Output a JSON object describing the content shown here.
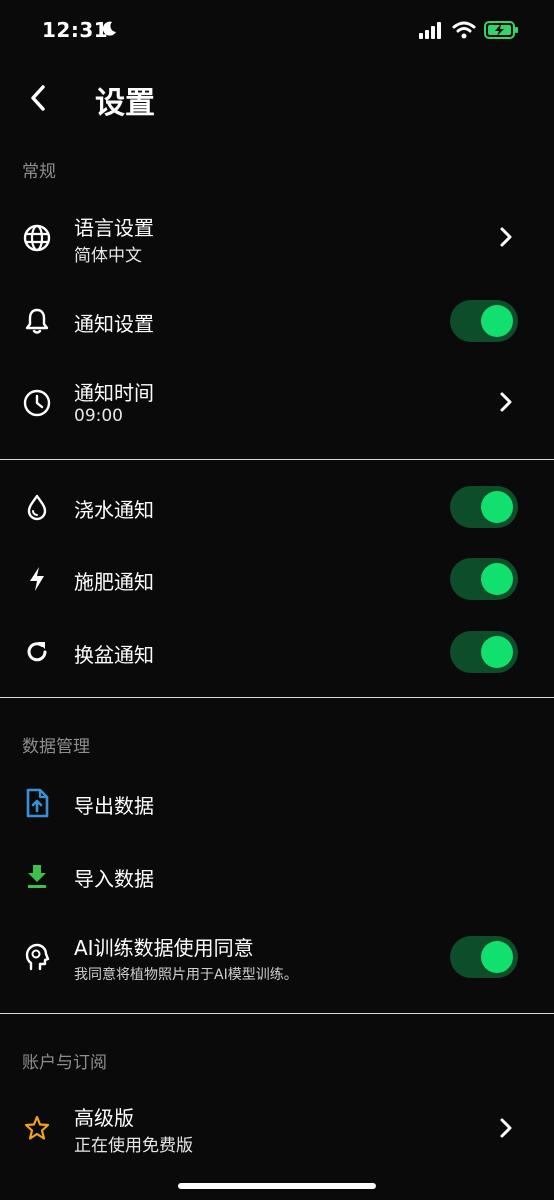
{
  "status_bar": {
    "time": "12:31"
  },
  "header": {
    "title": "设置"
  },
  "sections": {
    "general": {
      "label": "常规"
    },
    "data": {
      "label": "数据管理"
    },
    "account": {
      "label": "账户与订阅"
    }
  },
  "rows": {
    "language": {
      "title": "语言设置",
      "subtitle": "简体中文",
      "icon": "globe-icon"
    },
    "notification": {
      "title": "通知设置",
      "icon": "bell-icon",
      "enabled": true
    },
    "notify_time": {
      "title": "通知时间",
      "subtitle": "09:00",
      "icon": "clock-icon"
    },
    "watering": {
      "title": "浇水通知",
      "icon": "water-drop-icon",
      "enabled": true
    },
    "fertilize": {
      "title": "施肥通知",
      "icon": "lightning-icon",
      "enabled": true
    },
    "repot": {
      "title": "换盆通知",
      "icon": "refresh-icon",
      "enabled": true
    },
    "export": {
      "title": "导出数据",
      "icon": "file-upload-icon"
    },
    "import": {
      "title": "导入数据",
      "icon": "download-icon"
    },
    "ai_consent": {
      "title": "AI训练数据使用同意",
      "subtitle": "我同意将植物照片用于AI模型训练。",
      "icon": "head-icon",
      "enabled": true
    },
    "premium": {
      "title": "高级版",
      "subtitle": "正在使用免费版",
      "icon": "star-icon"
    }
  },
  "colors": {
    "background": "#0a0a0a",
    "toggle_track": "#0e4d2a",
    "toggle_knob": "#12e06e",
    "export_icon": "#3a8fd9",
    "import_icon": "#3cc14a",
    "star_icon": "#f2a11f"
  }
}
